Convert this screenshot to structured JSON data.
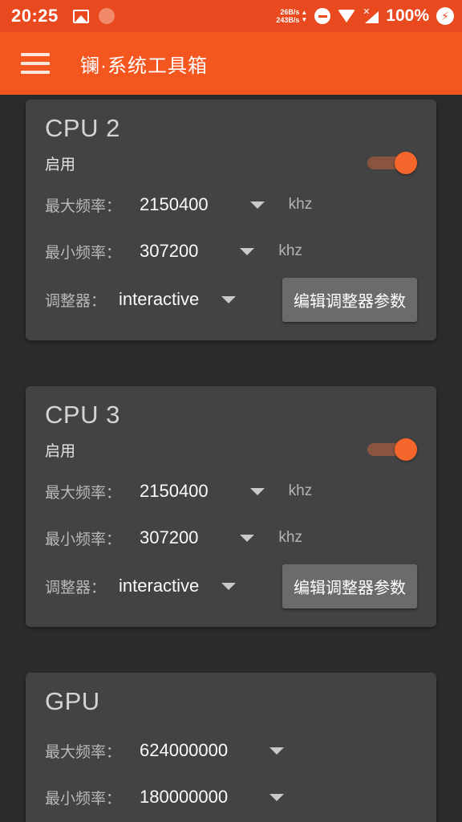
{
  "status_bar": {
    "time": "20:25",
    "icons_left": [
      "image-icon",
      "fingerprint-icon"
    ],
    "net_up": "26B/s",
    "net_down": "243B/s",
    "up_arrow": "▲",
    "down_arrow": "▼",
    "icons_right": [
      "do-not-disturb-icon",
      "wifi-icon",
      "signal-no-sim-icon"
    ],
    "battery_percent": "100%",
    "battery_state": "charging",
    "bg_color": "#e8491f"
  },
  "app_bar": {
    "menu_icon": "hamburger-menu-icon",
    "title": "镧·系统工具箱",
    "bg_color": "#f4561f"
  },
  "theme": {
    "page_bg": "#2b2b2b",
    "card_bg": "#434343",
    "accent": "#f4662b",
    "button_bg": "#6b6b6b"
  },
  "cards": [
    {
      "title": "CPU 2",
      "enable_label": "启用",
      "enabled": true,
      "max_freq_label": "最大频率：",
      "max_freq_value": "2150400",
      "max_freq_unit": "khz",
      "min_freq_label": "最小频率：",
      "min_freq_value": "307200",
      "min_freq_unit": "khz",
      "governor_label": "调整器：",
      "governor_value": "interactive",
      "edit_button": "编辑调整器参数"
    },
    {
      "title": "CPU 3",
      "enable_label": "启用",
      "enabled": true,
      "max_freq_label": "最大频率：",
      "max_freq_value": "2150400",
      "max_freq_unit": "khz",
      "min_freq_label": "最小频率：",
      "min_freq_value": "307200",
      "min_freq_unit": "khz",
      "governor_label": "调整器：",
      "governor_value": "interactive",
      "edit_button": "编辑调整器参数"
    },
    {
      "title": "GPU",
      "max_freq_label": "最大频率：",
      "max_freq_value": "624000000",
      "min_freq_label": "最小频率：",
      "min_freq_value": "180000000"
    }
  ]
}
